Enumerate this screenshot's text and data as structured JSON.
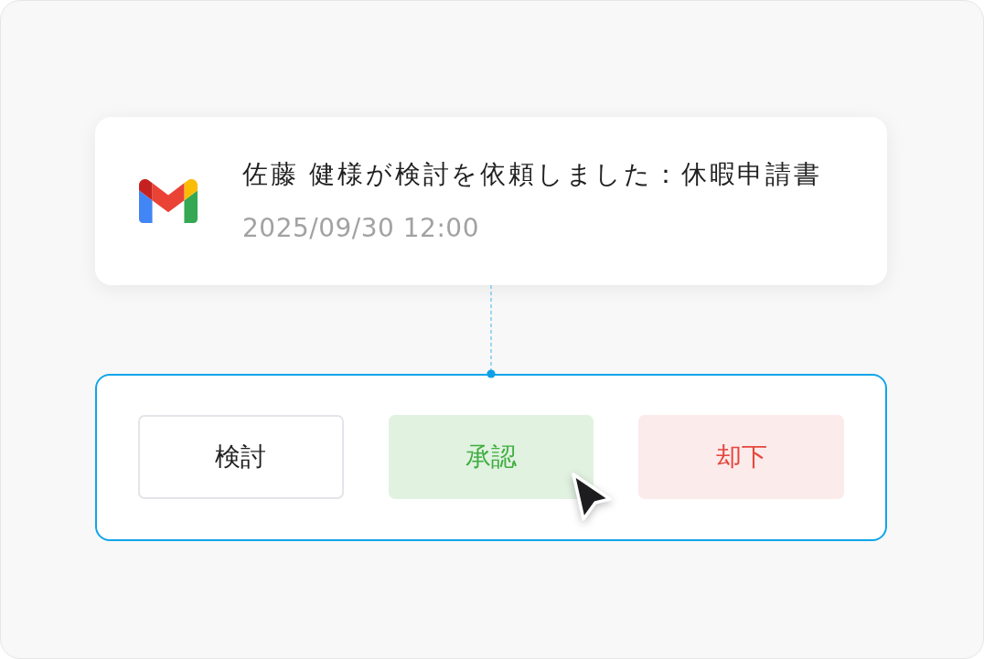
{
  "notification": {
    "title": "佐藤 健様が検討を依頼しました：休暇申請書",
    "timestamp": "2025/09/30 12:00"
  },
  "actions": [
    {
      "label": "検討",
      "kind": "review"
    },
    {
      "label": "承認",
      "kind": "approve"
    },
    {
      "label": "却下",
      "kind": "reject"
    }
  ]
}
